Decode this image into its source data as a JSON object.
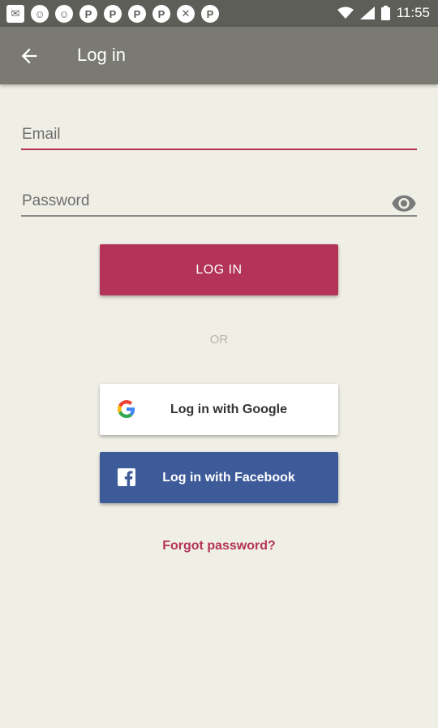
{
  "status_bar": {
    "time": "11:55",
    "notification_icons": [
      "email-icon",
      "cat-icon",
      "cat-icon",
      "pinterest-icon",
      "pinterest-icon",
      "pinterest-icon",
      "pinterest-icon",
      "tools-icon",
      "pinterest-icon"
    ]
  },
  "app_bar": {
    "title": "Log in"
  },
  "form": {
    "email_placeholder": "Email",
    "password_placeholder": "Password",
    "login_label": "LOG IN",
    "or_label": "OR",
    "google_label": "Log in with Google",
    "facebook_label": "Log in with Facebook",
    "forgot_label": "Forgot password?"
  },
  "colors": {
    "accent": "#b43358",
    "app_bar": "#7a7a72",
    "status_bar": "#5e5e58",
    "background": "#f0efe6",
    "facebook": "#3d5a99"
  }
}
